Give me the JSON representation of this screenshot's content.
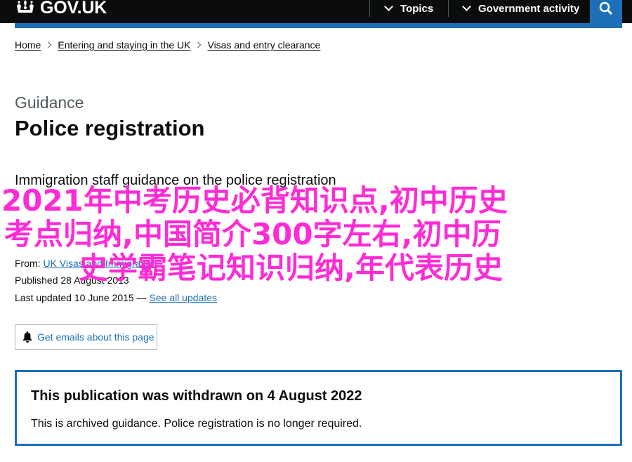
{
  "header": {
    "logo_text": "GOV.UK",
    "nav": [
      {
        "label": "Topics"
      },
      {
        "label": "Government activity"
      }
    ],
    "colors": {
      "header_bg": "#0b0c0c",
      "accent": "#1d70b8"
    }
  },
  "breadcrumb": [
    {
      "label": "Home"
    },
    {
      "label": "Entering and staying in the UK"
    },
    {
      "label": "Visas and entry clearance"
    }
  ],
  "page": {
    "caption": "Guidance",
    "title": "Police registration",
    "lead": "Immigration staff guidance on the police registration"
  },
  "meta": {
    "from_label": "From:",
    "from_value": "UK Visas and Immigration",
    "published": "Published 28 August 2013",
    "updated_label": "Last updated 10 June 2015 — ",
    "see_all": "See all updates"
  },
  "email_button": {
    "label": "Get emails about this page",
    "icon": "bell-icon"
  },
  "notice": {
    "title": "This publication was withdrawn on 4 August 2022",
    "body": "This is archived guidance. Police registration is no longer required."
  },
  "overlay": {
    "color": "#ff2bd6",
    "lines": [
      "2021年中考历史必背知识点,初中历史",
      "考点归纳,中国简介300字左右,初中历",
      "史学霸笔记知识归纳,年代表历史"
    ]
  }
}
